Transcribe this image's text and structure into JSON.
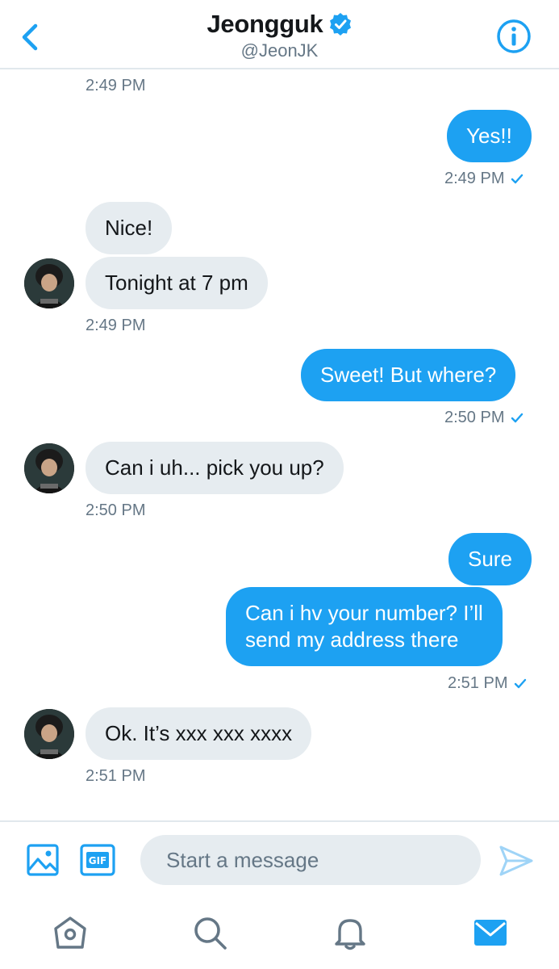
{
  "header": {
    "name": "Jeongguk",
    "handle": "@JeonJK"
  },
  "messages": [
    {
      "time": "2:49 PM"
    },
    {
      "text": "Yes!!",
      "time": "2:49 PM"
    },
    {
      "text": "Nice!"
    },
    {
      "text": "Tonight at 7 pm",
      "time": "2:49 PM"
    },
    {
      "text": "Sweet! But where?",
      "time": "2:50 PM"
    },
    {
      "text": "Can i uh... pick you up?",
      "time": "2:50 PM"
    },
    {
      "text": "Sure"
    },
    {
      "text_line1": "Can i hv your number? I’ll",
      "text_line2": "send my address there",
      "time": "2:51 PM"
    },
    {
      "text": "Ok. It’s xxx xxx xxxx",
      "time": "2:51 PM"
    }
  ],
  "composer": {
    "placeholder": "Start a message"
  },
  "tabs": [
    "home-icon",
    "search-icon",
    "bell-icon",
    "mail-icon"
  ],
  "colors": {
    "accent": "#1da1f2",
    "received_bubble": "#e6ecf0",
    "muted_text": "#657786"
  }
}
